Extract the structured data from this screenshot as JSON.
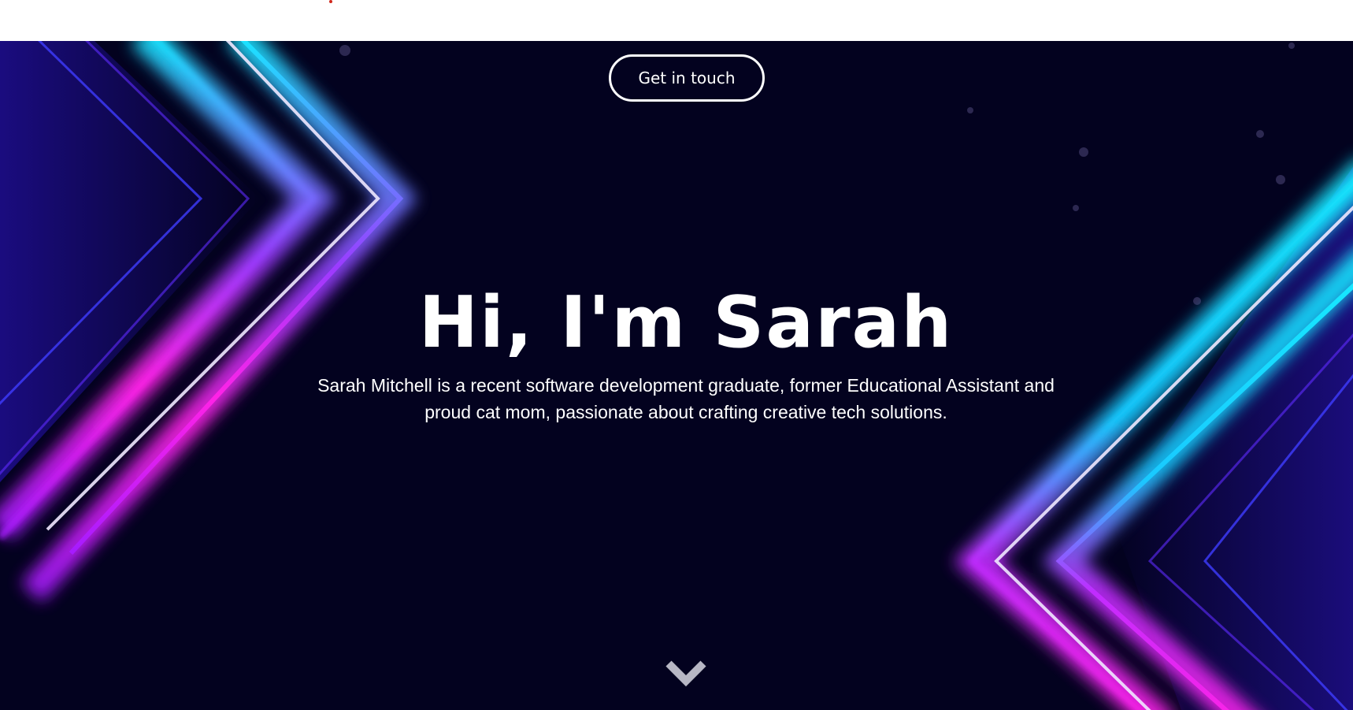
{
  "hero": {
    "cta_label": "Get in touch",
    "headline": "Hi, I'm Sarah",
    "intro": "Sarah Mitchell is a recent software development graduate, former Educational Assistant and proud cat mom, passionate about crafting creative tech solutions.",
    "scroll_icon": "chevron-down-icon"
  },
  "colors": {
    "background": "#03021f",
    "text": "#ffffff",
    "accent_cyan": "#19e6ff",
    "accent_magenta": "#ff1fe6",
    "accent_violet": "#6b2bff",
    "chevron": "#b7b7c4"
  }
}
